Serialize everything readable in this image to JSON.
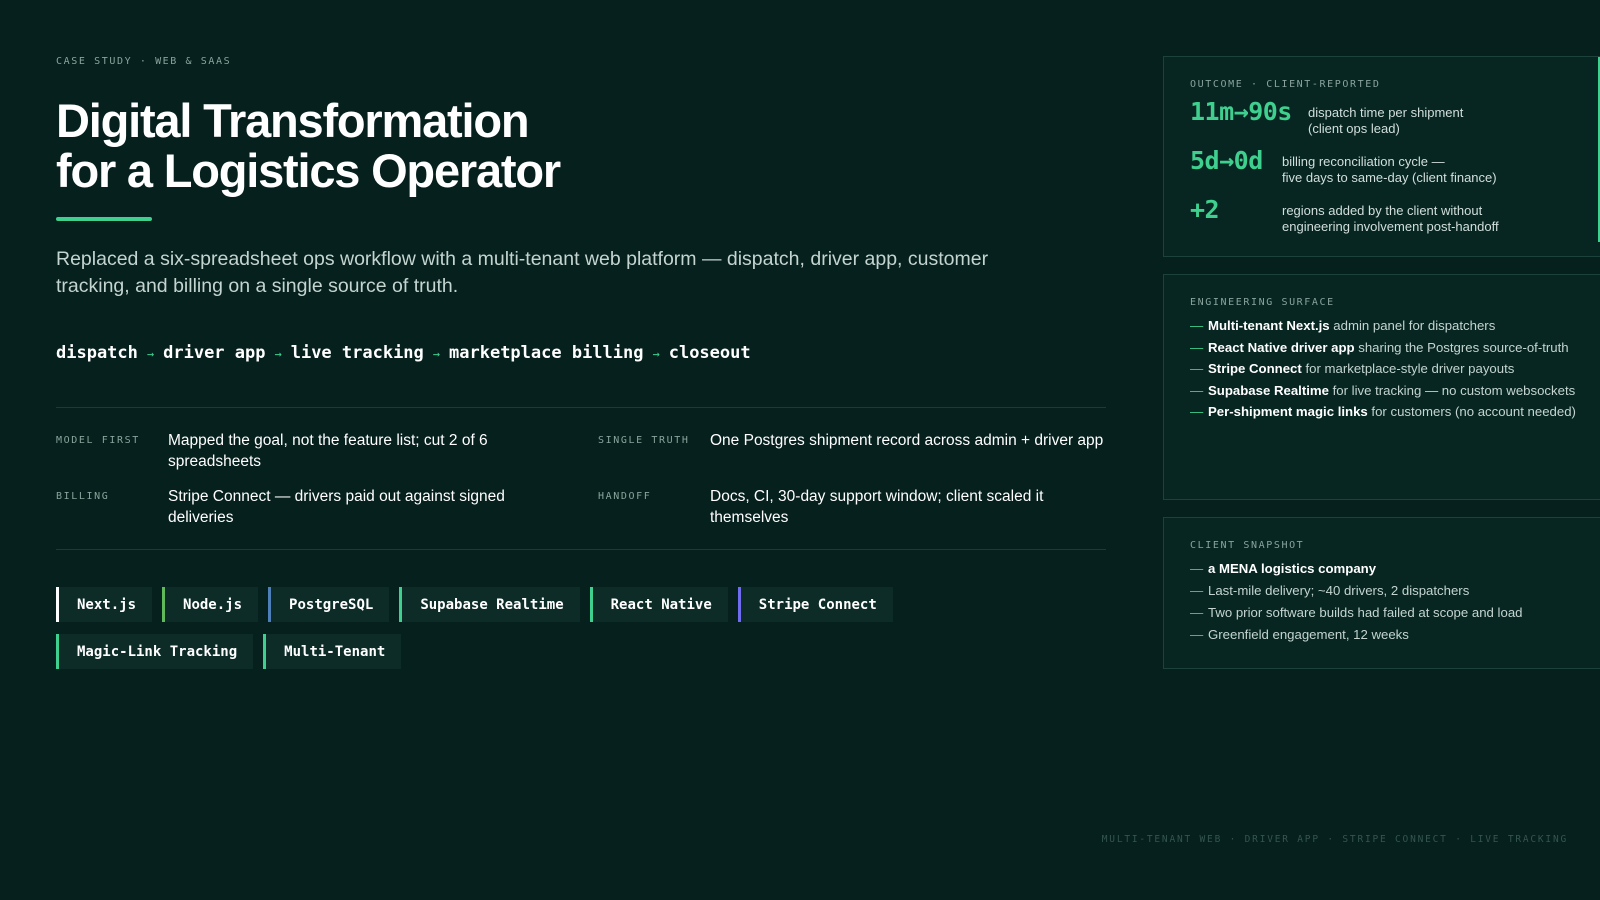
{
  "eyebrow": "CASE STUDY · WEB & SAAS",
  "title": {
    "line1": "Digital Transformation",
    "line2": "for a Logistics Operator"
  },
  "lede": "Replaced a six-spreadsheet ops workflow with a multi-tenant web platform — dispatch, driver app, customer tracking, and billing on a single source of truth.",
  "pipeline": {
    "steps": [
      "dispatch",
      "driver app",
      "live tracking",
      "marketplace billing",
      "closeout"
    ],
    "separator": "→"
  },
  "facts": [
    {
      "label": "MODEL FIRST",
      "text": "Mapped the goal, not the feature list; cut 2 of 6 spreadsheets"
    },
    {
      "label": "SINGLE TRUTH",
      "text": "One Postgres shipment record across admin + driver app"
    },
    {
      "label": "BILLING",
      "text": "Stripe Connect — drivers paid out against signed deliveries"
    },
    {
      "label": "HANDOFF",
      "text": "Docs, CI, 30-day support window; client scaled it themselves"
    }
  ],
  "tags": [
    {
      "label": "Next.js",
      "color": "#ffffff"
    },
    {
      "label": "Node.js",
      "color": "#5fb85a"
    },
    {
      "label": "PostgreSQL",
      "color": "#4f7fb8"
    },
    {
      "label": "Supabase Realtime",
      "color": "#3fcf8e"
    },
    {
      "label": "React Native",
      "color": "#3fcf8e"
    },
    {
      "label": "Stripe Connect",
      "color": "#6f6cf0"
    },
    {
      "label": "Magic-Link Tracking",
      "color": "#3fcf8e"
    },
    {
      "label": "Multi-Tenant",
      "color": "#3fcf8e"
    }
  ],
  "outcome": {
    "label": "OUTCOME · CLIENT-REPORTED",
    "metrics": [
      {
        "value": "11m→90s",
        "line1": "dispatch time per shipment",
        "line2": "(client ops lead)"
      },
      {
        "value": "5d→0d",
        "line1": "billing reconciliation cycle —",
        "line2": "five days to same-day (client finance)"
      },
      {
        "value": "+2",
        "line1": "regions added by the client without",
        "line2": "engineering involvement post-handoff"
      }
    ]
  },
  "surface": {
    "label": "ENGINEERING SURFACE",
    "items": [
      {
        "strong": "Multi-tenant Next.js",
        "rest": " admin panel for dispatchers"
      },
      {
        "strong": "React Native driver app",
        "rest": " sharing the Postgres source-of-truth"
      },
      {
        "strong": "Stripe Connect",
        "rest": " for marketplace-style driver payouts"
      },
      {
        "strong": "Supabase Realtime",
        "rest": " for live tracking — no custom websockets"
      },
      {
        "strong": "Per-shipment magic links",
        "rest": " for customers (no account needed)"
      }
    ]
  },
  "snapshot": {
    "label": "CLIENT SNAPSHOT",
    "items": [
      {
        "strong": "a MENA logistics company",
        "rest": ""
      },
      {
        "strong": "",
        "rest": "Last-mile delivery; ~40 drivers, 2 dispatchers"
      },
      {
        "strong": "",
        "rest": "Two prior software builds had failed at scope and load"
      },
      {
        "strong": "",
        "rest": "Greenfield engagement, 12 weeks"
      }
    ]
  },
  "list_marker": "—",
  "footer": "MULTI-TENANT WEB · DRIVER APP · STRIPE CONNECT · LIVE TRACKING"
}
